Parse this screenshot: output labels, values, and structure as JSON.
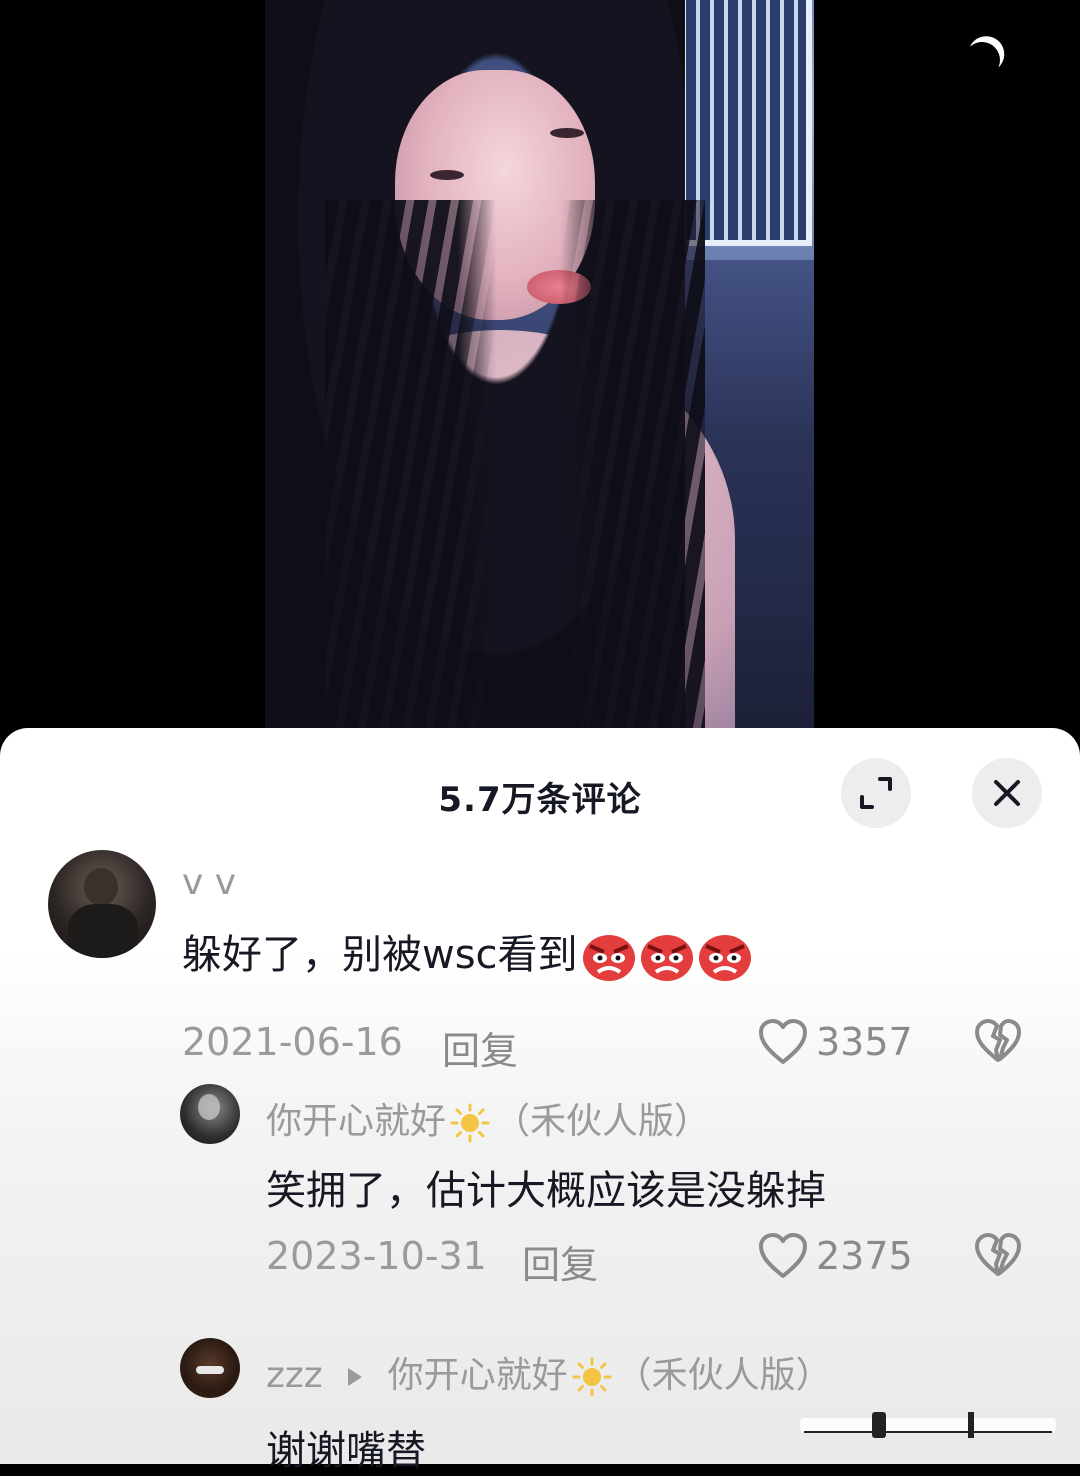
{
  "sheet": {
    "title": "5.7万条评论"
  },
  "comments": [
    {
      "username": "v v",
      "text": "躲好了，别被wsc看到",
      "emoji": [
        "angry-face",
        "angry-face",
        "angry-face"
      ],
      "date": "2021-06-16",
      "reply_label": "回复",
      "likes": "3357"
    },
    {
      "username_prefix": "你开心就好",
      "username_suffix": "（禾伙人版）",
      "text": "笑拥了，估计大概应该是没躲掉",
      "date": "2023-10-31",
      "reply_label": "回复",
      "likes": "2375"
    },
    {
      "username": "zzz",
      "reply_to_prefix": "你开心就好",
      "reply_to_suffix": "（禾伙人版）",
      "text": "谢谢嘴替"
    }
  ],
  "colors": {
    "sheet_bg": "#ffffff",
    "primary_text": "#161823",
    "secondary_text": "#9a9a9a",
    "button_bg": "#ededed"
  },
  "icons": [
    "moon-icon",
    "expand-icon",
    "close-icon",
    "heart-icon",
    "broken-heart-icon",
    "sun-icon",
    "angry-face-icon",
    "reply-arrow-icon"
  ]
}
